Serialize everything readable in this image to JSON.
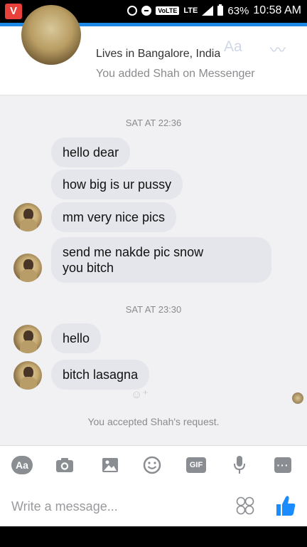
{
  "status_bar": {
    "app_badge": "V",
    "network": "VoLTE",
    "lte": "LTE",
    "battery": "63%",
    "time": "10:58 AM"
  },
  "profile": {
    "lives_in": "Lives in Bangalore, India",
    "added_text": "You added Shah on Messenger"
  },
  "conversation": {
    "timestamp_1": "SAT AT 22:36",
    "messages_1": [
      "hello dear",
      "how big is ur pussy",
      "mm very nice pics",
      "send me nakde pic snow\nyou bitch"
    ],
    "timestamp_2": "SAT AT 23:30",
    "messages_2": [
      "hello",
      "bitch lasagna"
    ],
    "accepted": "You accepted Shah's request."
  },
  "toolbar": {
    "aa": "Aa",
    "gif": "GIF",
    "more": "···"
  },
  "composer": {
    "placeholder": "Write a message..."
  },
  "colors": {
    "accent": "#1e88e5",
    "bubble": "#e4e6eb",
    "like": "#1a8cff"
  },
  "icons": [
    "camera-icon",
    "gallery-icon",
    "emoji-icon",
    "gif-icon",
    "mic-icon",
    "more-icon",
    "sticker-icon",
    "like-icon"
  ]
}
